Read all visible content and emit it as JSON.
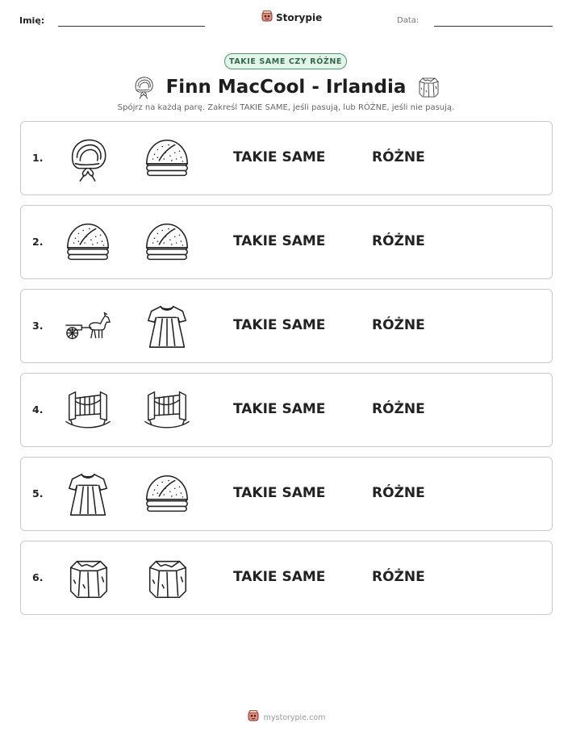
{
  "header": {
    "name_label": "Imię:",
    "brand": "Storypie",
    "date_label": "Data:"
  },
  "worksheet": {
    "badge": "TAKIE SAME CZY RÓŻNE",
    "title": "Finn MacCool - Irlandia",
    "instructions": "Spójrz na każdą parę. Zakreśl TAKIE SAME, jeśli pasują, lub RÓŻNE, jeśli nie pasują.",
    "option_same": "TAKIE SAME",
    "option_different": "RÓŻNE"
  },
  "rows": [
    {
      "number": "1.",
      "left_icon": "bonnet-icon",
      "right_icon": "bread-loaf-icon"
    },
    {
      "number": "2.",
      "left_icon": "bread-loaf-icon",
      "right_icon": "bread-loaf-icon"
    },
    {
      "number": "3.",
      "left_icon": "horse-cart-icon",
      "right_icon": "dress-icon"
    },
    {
      "number": "4.",
      "left_icon": "cradle-icon",
      "right_icon": "cradle-icon"
    },
    {
      "number": "5.",
      "left_icon": "dress-icon",
      "right_icon": "bread-loaf-icon"
    },
    {
      "number": "6.",
      "left_icon": "stone-block-icon",
      "right_icon": "stone-block-icon"
    }
  ],
  "footer": {
    "site": "mystorypie.com"
  }
}
